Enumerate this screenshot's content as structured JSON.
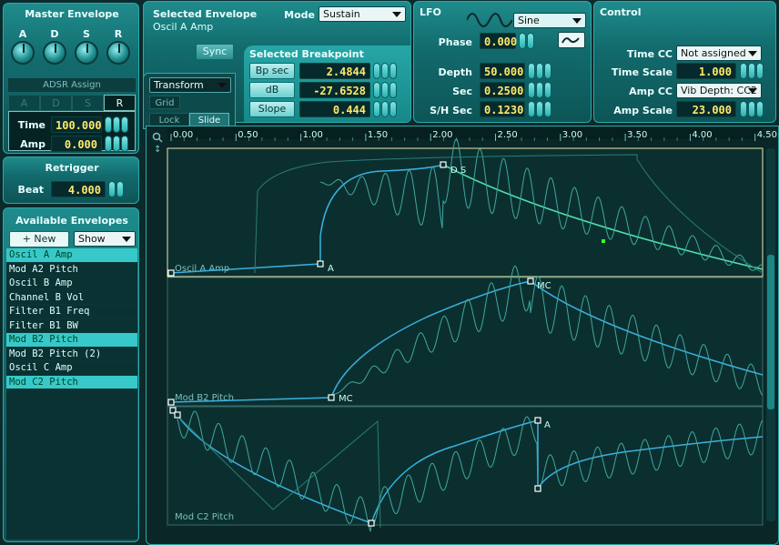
{
  "master": {
    "title": "Master Envelope",
    "knobs": [
      "A",
      "D",
      "S",
      "R"
    ],
    "adsr_assign": "ADSR Assign",
    "adsr_tabs": [
      "A",
      "D",
      "S",
      "R"
    ],
    "time_label": "Time",
    "time_value": "100.000",
    "amp_label": "Amp",
    "amp_value": "0.000"
  },
  "retrigger": {
    "title": "Retrigger",
    "beat_label": "Beat",
    "beat_value": "4.000"
  },
  "available": {
    "title": "Available Envelopes",
    "new_label": "+ New",
    "show_label": "Show",
    "items": [
      {
        "label": "Oscil A Amp",
        "selected": true
      },
      {
        "label": "Mod A2 Pitch",
        "selected": false
      },
      {
        "label": "Oscil B Amp",
        "selected": false
      },
      {
        "label": "Channel B Vol",
        "selected": false
      },
      {
        "label": "Filter B1 Freq",
        "selected": false
      },
      {
        "label": "Filter B1 BW",
        "selected": false
      },
      {
        "label": "Mod B2 Pitch",
        "selected": true
      },
      {
        "label": "Mod B2 Pitch (2)",
        "selected": false
      },
      {
        "label": "Oscil C Amp",
        "selected": false
      },
      {
        "label": "Mod C2 Pitch",
        "selected": true
      }
    ]
  },
  "selected": {
    "title": "Selected Envelope",
    "name": "Oscil A Amp",
    "mode_label": "Mode",
    "mode_value": "Sustain",
    "sync_label": "Sync",
    "bp_title": "Selected Breakpoint",
    "bp_sec_label": "Bp sec",
    "bp_sec_value": "2.4844",
    "db_label": "dB",
    "db_value": "-27.6528",
    "slope_label": "Slope",
    "slope_value": "0.444"
  },
  "lfo": {
    "title": "LFO",
    "wave": "Sine",
    "phase_label": "Phase",
    "phase_value": "0.000",
    "depth_label": "Depth",
    "depth_value": "50.000",
    "sec_label": "Sec",
    "sec_value": "0.2500",
    "sh_label": "S/H Sec",
    "sh_value": "0.1230"
  },
  "control": {
    "title": "Control",
    "timecc_label": "Time CC",
    "timecc_value": "Not assigned",
    "timescale_label": "Time Scale",
    "timescale_value": "1.000",
    "ampcc_label": "Amp CC",
    "ampcc_value": "Vib Depth: CC2",
    "ampscale_label": "Amp Scale",
    "ampscale_value": "23.000"
  },
  "tools": {
    "transform": "Transform",
    "grid": "Grid",
    "lock": "Lock",
    "slide": "Slide"
  },
  "ruler": [
    "0.00",
    "0.50",
    "1.00",
    "1.50",
    "2.00",
    "2.50",
    "3.00",
    "3.50",
    "4.00",
    "4.50"
  ],
  "lanes": [
    {
      "name": "Oscil A Amp",
      "markers": [
        "A",
        "D S"
      ]
    },
    {
      "name": "Mod B2 Pitch",
      "markers": [
        "MC",
        "MC"
      ]
    },
    {
      "name": "Mod C2 Pitch",
      "markers": [
        "A"
      ]
    }
  ],
  "colors": {
    "accent": "#37c9c9",
    "value_text": "#ffe96a",
    "curve": "#3ab0e0",
    "lfo": "#3fa9a0"
  }
}
